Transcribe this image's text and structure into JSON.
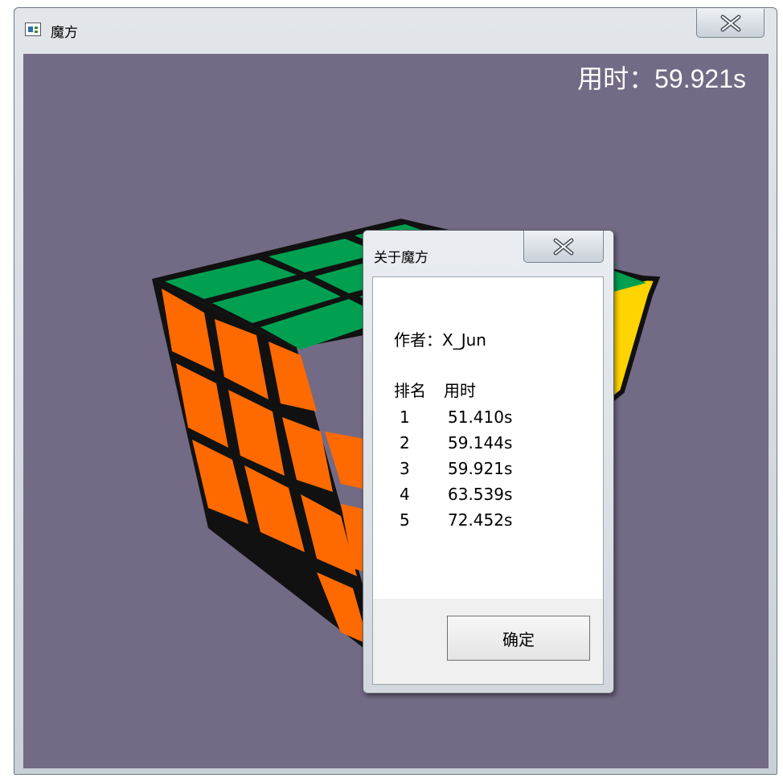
{
  "window": {
    "title": "魔方",
    "close_icon": "close-x-icon",
    "app_icon": "app-window-icon"
  },
  "timer": {
    "label": "用时：",
    "value": "59.921s"
  },
  "cube": {
    "colors": {
      "top": "#00a050",
      "front": "#ff6a00",
      "right": "#ffd400",
      "edge": "#111111",
      "background": "#736a85"
    }
  },
  "dialog": {
    "title": "关于魔方",
    "author": "作者：X_Jun",
    "ranking": {
      "header_rank": "排名",
      "header_time": "用时",
      "rows": [
        {
          "rank": "1",
          "time": "51.410s"
        },
        {
          "rank": "2",
          "time": "59.144s"
        },
        {
          "rank": "3",
          "time": "59.921s"
        },
        {
          "rank": "4",
          "time": "63.539s"
        },
        {
          "rank": "5",
          "time": "72.452s"
        }
      ]
    },
    "ok_label": "确定"
  }
}
